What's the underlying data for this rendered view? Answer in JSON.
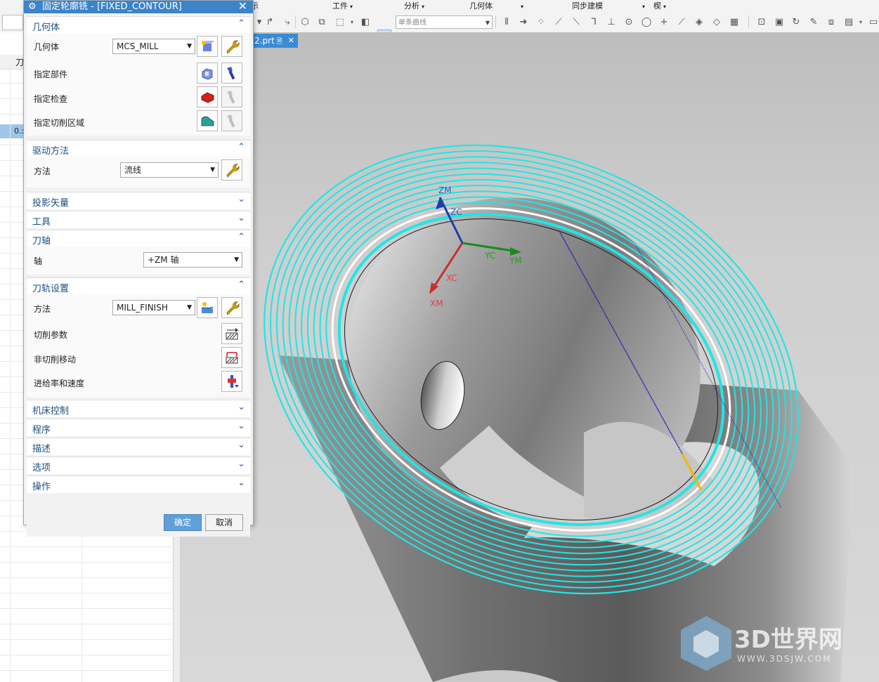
{
  "toolbar": {
    "menus": [
      {
        "label": "示"
      },
      {
        "label": "工件"
      },
      {
        "label": "分析"
      },
      {
        "label": "几何体"
      },
      {
        "label": "同步建模"
      },
      {
        "label": "楔"
      }
    ],
    "curve_selector": "单条曲线"
  },
  "navigator": {
    "column_header": "刀",
    "selected_value": "0.:"
  },
  "file_tab": {
    "name": "2.prt"
  },
  "dialog": {
    "title": "固定轮廓铣 - [FIXED_CONTOUR]",
    "sections": {
      "geometry": {
        "title": "几何体",
        "geometry_label": "几何体",
        "geometry_value": "MCS_MILL",
        "specify_part": "指定部件",
        "specify_check": "指定检查",
        "specify_cut_area": "指定切削区域"
      },
      "drive_method": {
        "title": "驱动方法",
        "method_label": "方法",
        "method_value": "流线"
      },
      "projection_vector": {
        "title": "投影矢量"
      },
      "tool": {
        "title": "工具"
      },
      "tool_axis": {
        "title": "刀轴",
        "axis_label": "轴",
        "axis_value": "+ZM 轴"
      },
      "path_settings": {
        "title": "刀轨设置",
        "method_label": "方法",
        "method_value": "MILL_FINISH",
        "cut_params": "切削参数",
        "non_cut_moves": "非切削移动",
        "feeds_speeds": "进给率和速度"
      },
      "machine_control": {
        "title": "机床控制"
      },
      "program": {
        "title": "程序"
      },
      "description": {
        "title": "描述"
      },
      "options": {
        "title": "选项"
      },
      "actions": {
        "title": "操作"
      }
    },
    "ok_label": "确定",
    "cancel_label": "取消"
  },
  "viewport": {
    "axis_labels": {
      "zm": "ZM",
      "zc": "ZC",
      "yc": "YC",
      "ym": "YM",
      "xc": "XC",
      "xm": "XM"
    },
    "toolpath_color": "#1ee6e6"
  },
  "watermark": {
    "brand": "3D世界网",
    "url": "WWW.3DSJW.COM"
  }
}
